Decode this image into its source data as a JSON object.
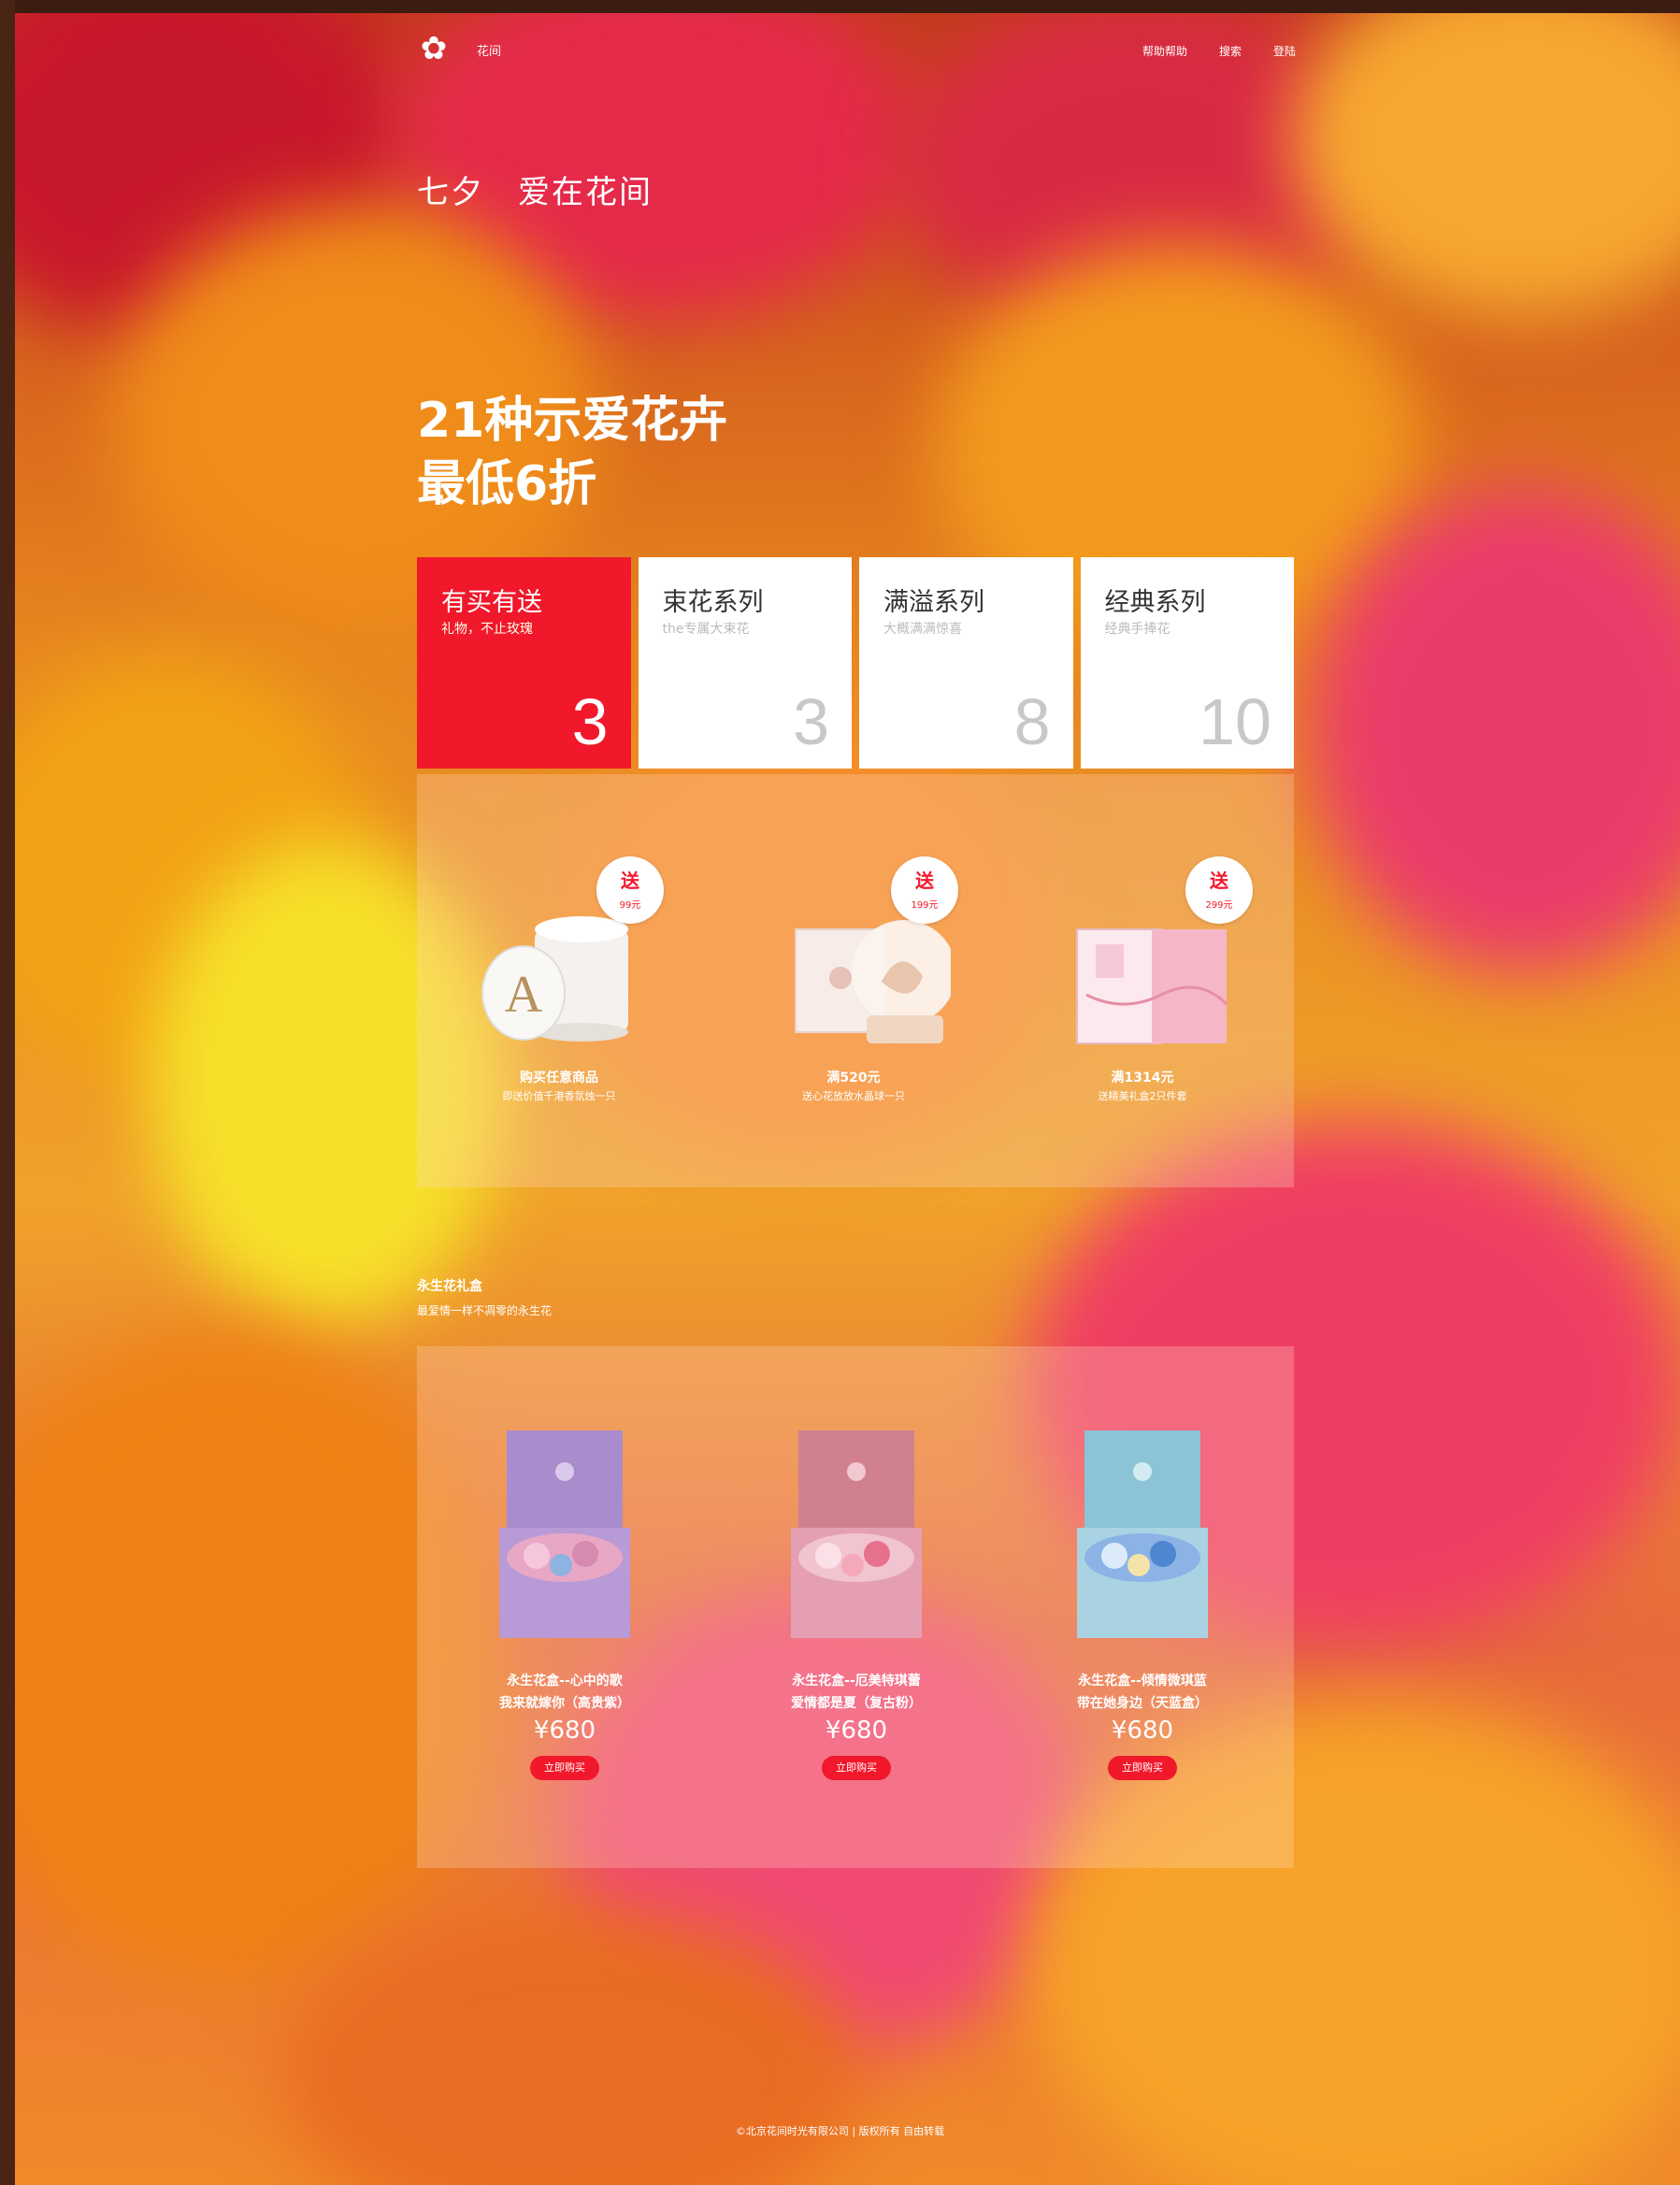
{
  "header": {
    "brand": "花间",
    "nav": [
      "帮助帮助",
      "搜索",
      "登陆"
    ]
  },
  "hero": {
    "subtitle": "七夕　爱在花间",
    "headline_line1": "21种示爱花卉",
    "headline_line2": "最低6折"
  },
  "categories": [
    {
      "title": "有买有送",
      "desc": "礼物，不止玫瑰",
      "count": "3",
      "active": true
    },
    {
      "title": "束花系列",
      "desc": "the专属大束花",
      "count": "3",
      "active": false
    },
    {
      "title": "满溢系列",
      "desc": "大概满满惊喜",
      "count": "8",
      "active": false
    },
    {
      "title": "经典系列",
      "desc": "经典手捧花",
      "count": "10",
      "active": false
    }
  ],
  "gifts": [
    {
      "badge": "送",
      "badge_price": "99元",
      "name": "购买任意商品",
      "desc": "即送价值千港香氛烛一只",
      "icon": "candle-icon"
    },
    {
      "badge": "送",
      "badge_price": "199元",
      "name": "满520元",
      "desc": "送心花放放水晶球一只",
      "icon": "snow-globe-icon"
    },
    {
      "badge": "送",
      "badge_price": "299元",
      "name": "满1314元",
      "desc": "送精美礼盒2只件套",
      "icon": "gift-box-icon"
    }
  ],
  "eternal": {
    "title": "永生花礼盒",
    "subtitle": "最爱情一样不凋零的永生花",
    "products": [
      {
        "name_line1": "永生花盒--心中的歌",
        "name_line2": "我来就嫁你（高贵紫）",
        "price": "¥680",
        "button": "立即购买",
        "box_color": "#b89ad6",
        "lid_color": "#a98ccc",
        "flower_color": "#e9a7c6"
      },
      {
        "name_line1": "永生花盒--厄美特琪蕾",
        "name_line2": "爱情都是夏（复古粉）",
        "price": "¥680",
        "button": "立即购买",
        "box_color": "#e4a0b2",
        "lid_color": "#d0808f",
        "flower_color": "#f1c4cf"
      },
      {
        "name_line1": "永生花盒--倾情微琪蓝",
        "name_line2": "带在她身边（天蓝盒）",
        "price": "¥680",
        "button": "立即购买",
        "box_color": "#a9d3e2",
        "lid_color": "#8cc3d6",
        "flower_color": "#8bb3e6"
      }
    ]
  },
  "footer": "©北京花间时光有限公司 | 版权所有 自由转载"
}
